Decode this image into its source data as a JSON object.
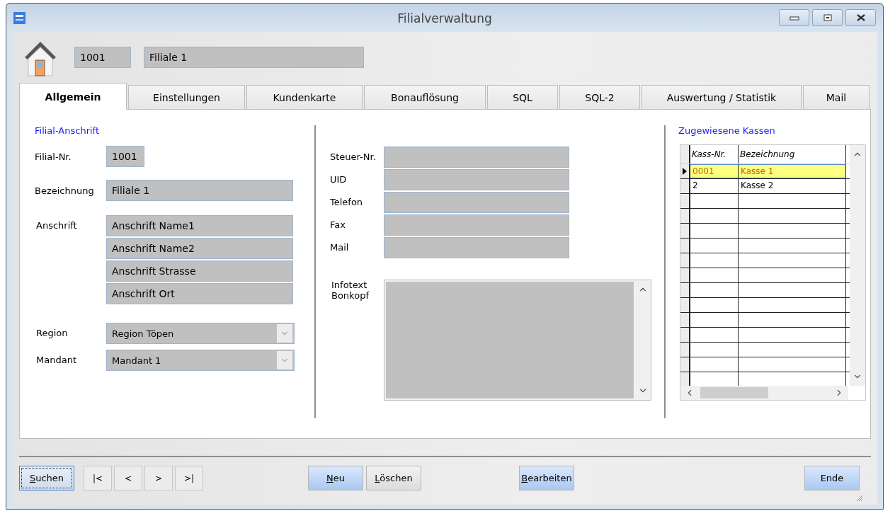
{
  "window": {
    "title": "Filialverwaltung"
  },
  "header": {
    "number": "1001",
    "name": "Filiale 1"
  },
  "tabs": [
    {
      "label": "Allgemein",
      "selected": true
    },
    {
      "label": "Einstellungen",
      "selected": false
    },
    {
      "label": "Kundenkarte",
      "selected": false
    },
    {
      "label": "Bonauflösung",
      "selected": false
    },
    {
      "label": "SQL",
      "selected": false
    },
    {
      "label": "SQL-2",
      "selected": false
    },
    {
      "label": "Auswertung / Statistik",
      "selected": false
    },
    {
      "label": "Mail",
      "selected": false
    }
  ],
  "address": {
    "heading": "Filial-Anschrift",
    "filial_nr": {
      "label": "Filial-Nr.",
      "value": "1001"
    },
    "bezeichnung": {
      "label": "Bezeichnung",
      "value": "Filiale 1"
    },
    "anschrift": {
      "label": "Anschrift",
      "lines": [
        "Anschrift Name1",
        "Anschrift Name2",
        "Anschrift Strasse",
        "Anschrift Ort"
      ]
    },
    "region": {
      "label": "Region",
      "value": "Region Töpen"
    },
    "mandant": {
      "label": "Mandant",
      "value": "Mandant 1"
    }
  },
  "contact": [
    {
      "label": "Steuer-Nr."
    },
    {
      "label": "UID"
    },
    {
      "label": "Telefon"
    },
    {
      "label": "Fax"
    },
    {
      "label": "Mail"
    }
  ],
  "infotext": {
    "label": "Infotext Bonkopf"
  },
  "kassen": {
    "heading": "Zugewiesene Kassen",
    "columns": [
      "Kass-Nr.",
      "Bezeichnung"
    ],
    "rows": [
      {
        "cells": [
          "0001",
          "Kasse 1"
        ],
        "selected": true
      },
      {
        "cells": [
          "2",
          "Kasse 2"
        ],
        "selected": false
      }
    ]
  },
  "footer": {
    "search": {
      "label": "Suchen",
      "mnemonic": true,
      "focused": true,
      "primary": false
    },
    "record_nav": [
      "|<",
      "<",
      ">",
      ">|"
    ],
    "actions": [
      {
        "label": "Neu",
        "mnemonic": true,
        "focused": false,
        "primary": true
      },
      {
        "label": "Löschen",
        "mnemonic": true,
        "focused": false,
        "primary": false
      }
    ],
    "edit": {
      "label": "Bearbeiten",
      "mnemonic": true,
      "focused": false,
      "primary": true
    },
    "close": {
      "label": "Ende",
      "mnemonic": false,
      "focused": false,
      "primary": true
    }
  }
}
